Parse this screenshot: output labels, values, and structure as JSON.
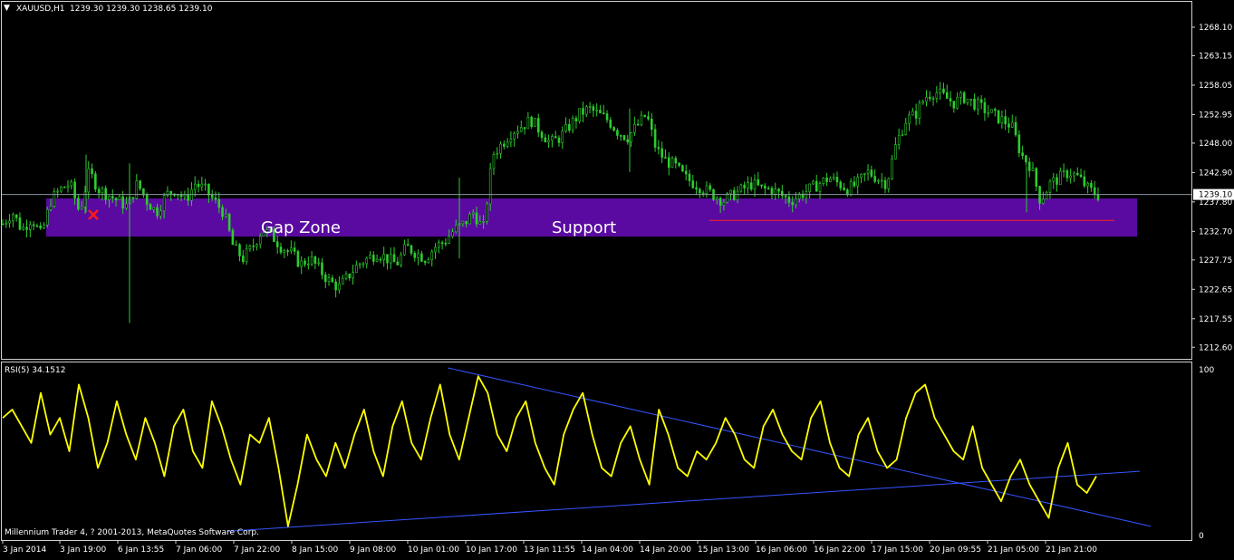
{
  "chart_header": {
    "symbol": "XAUUSD,H1",
    "ohlc": "1239.30 1239.30 1238.65 1239.10",
    "menu_icon": "triangle-down-icon"
  },
  "annotations": {
    "gap_zone_label": "Gap Zone",
    "support_label": "Support",
    "zone_color": "#5a0aa0",
    "support_line_color": "#ff2020",
    "marker": "red-x-marker"
  },
  "rsi_panel": {
    "label": "RSI(5) 34.1512",
    "axis_top": "100",
    "axis_bottom": "0",
    "line_color": "#ffff00",
    "trendline_color": "#3355ff"
  },
  "copyright": "Millennium Trader 4, ? 2001-2013, MetaQuotes Software Corp.",
  "chart_data": [
    {
      "type": "candlestick",
      "title": "XAUUSD,H1",
      "price_axis_ticks": [
        "1268.10",
        "1263.15",
        "1258.05",
        "1252.95",
        "1248.00",
        "1242.90",
        "1237.80",
        "1232.70",
        "1227.75",
        "1222.65",
        "1217.55",
        "1212.60"
      ],
      "current_price": "1239.10",
      "ylim": [
        1210.6,
        1272.5
      ],
      "x_ticks": [
        "3 Jan 2014",
        "3 Jan 19:00",
        "6 Jan 13:55",
        "7 Jan 06:00",
        "7 Jan 22:00",
        "8 Jan 15:00",
        "9 Jan 08:00",
        "10 Jan 01:00",
        "10 Jan 17:00",
        "13 Jan 11:55",
        "14 Jan 04:00",
        "14 Jan 20:00",
        "15 Jan 13:00",
        "16 Jan 06:00",
        "16 Jan 22:00",
        "17 Jan 15:00",
        "20 Jan 09:55",
        "21 Jan 05:00",
        "21 Jan 21:00"
      ],
      "close_path": [
        1234,
        1236,
        1233,
        1235,
        1232,
        1238,
        1240,
        1241,
        1236,
        1243,
        1240,
        1239,
        1238,
        1237,
        1241,
        1238,
        1236,
        1239,
        1240,
        1238,
        1241,
        1240,
        1238,
        1236,
        1230,
        1228,
        1230,
        1233,
        1232,
        1230,
        1229,
        1227,
        1228,
        1226,
        1224,
        1223,
        1225,
        1227,
        1228,
        1229,
        1228,
        1227,
        1230,
        1229,
        1228,
        1230,
        1231,
        1233,
        1234,
        1236,
        1233,
        1246,
        1248,
        1250,
        1251,
        1252,
        1250,
        1248,
        1249,
        1251,
        1253,
        1254,
        1253,
        1252,
        1250,
        1249,
        1251,
        1253,
        1247,
        1245,
        1244,
        1242,
        1241,
        1240,
        1239,
        1238,
        1239,
        1240,
        1241,
        1240,
        1240,
        1239,
        1238,
        1239,
        1240,
        1241,
        1242,
        1241,
        1240,
        1241,
        1243,
        1242,
        1241,
        1248,
        1252,
        1253,
        1256,
        1257,
        1256,
        1255,
        1256,
        1255,
        1254,
        1253,
        1252,
        1251,
        1246,
        1244,
        1238,
        1241,
        1242,
        1243,
        1242,
        1240,
        1239
      ],
      "gap_zone": [
        1231.8,
        1238.4
      ],
      "support_level": 1234.6
    },
    {
      "type": "line",
      "title": "RSI(5) 34.1512",
      "ylim": [
        0,
        100
      ],
      "values": [
        70,
        75,
        65,
        55,
        85,
        60,
        70,
        50,
        90,
        70,
        40,
        55,
        80,
        60,
        45,
        70,
        55,
        35,
        65,
        75,
        50,
        40,
        80,
        65,
        45,
        30,
        60,
        55,
        70,
        40,
        5,
        30,
        60,
        45,
        35,
        55,
        40,
        60,
        75,
        50,
        35,
        65,
        80,
        55,
        45,
        70,
        90,
        60,
        45,
        70,
        95,
        85,
        60,
        50,
        70,
        80,
        55,
        40,
        30,
        60,
        75,
        85,
        60,
        40,
        35,
        55,
        65,
        45,
        30,
        75,
        60,
        40,
        35,
        50,
        45,
        55,
        70,
        60,
        45,
        40,
        65,
        75,
        60,
        50,
        45,
        70,
        80,
        55,
        40,
        35,
        60,
        70,
        50,
        40,
        45,
        70,
        85,
        90,
        70,
        60,
        50,
        45,
        65,
        40,
        30,
        20,
        35,
        45,
        30,
        20,
        10,
        40,
        55,
        30,
        25,
        35
      ],
      "trendline_down": {
        "from": [
          0.375,
          100
        ],
        "to": [
          0.93,
          5
        ]
      },
      "trendline_up": {
        "from": [
          0.19,
          2
        ],
        "to": [
          0.925,
          38
        ]
      }
    }
  ]
}
